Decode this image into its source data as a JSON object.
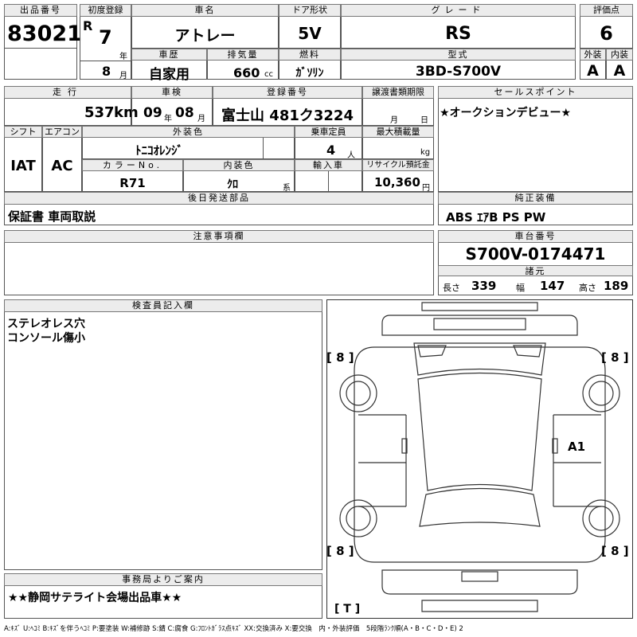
{
  "headers": {
    "lot_no": "出品番号",
    "first_reg": "初度登録",
    "car_name": "車名",
    "door": "ドア形状",
    "grade": "グレード",
    "score": "評価点",
    "history": "車歴",
    "displacement": "排気量",
    "fuel": "燃料",
    "model": "型式",
    "exterior": "外装",
    "interior": "内装",
    "mileage": "走行",
    "inspection": "車検",
    "plate": "登録番号",
    "transfer": "譲渡書類期限",
    "sales_point": "セールスポイント",
    "shift": "シフト",
    "aircon": "エアコン",
    "ext_color": "外装色",
    "capacity": "乗車定員",
    "max_load": "最大積載量",
    "color_no": "カラーNo.",
    "int_color": "内装色",
    "import": "輸入車",
    "recycle": "リサイクル預託金",
    "later_parts": "後日発送部品",
    "genuine_equip": "純正装備",
    "notes": "注意事項欄",
    "chassis_no": "車台番号",
    "dimensions": "諸元",
    "inspector": "検査員記入欄",
    "office": "事務局よりご案内"
  },
  "vehicle": {
    "lot_no": "83021",
    "era": "R",
    "year": "7",
    "year_unit": "年",
    "month": "8",
    "month_unit": "月",
    "name": "アトレー",
    "door": "5V",
    "grade": "RS",
    "score": "6",
    "history": "自家用",
    "displacement": "660",
    "displacement_unit": "cc",
    "fuel": "ｶﾞｿﾘﾝ",
    "model": "3BD-S700V",
    "ext_score": "A",
    "int_score": "A",
    "mileage": "537",
    "mileage_unit": "km",
    "inspection_year": "09",
    "inspection_year_unit": "年",
    "inspection_month": "08",
    "inspection_month_unit": "月",
    "plate": "富士山 481ク3224",
    "transfer_month_unit": "月",
    "transfer_day_unit": "日",
    "shift": "IAT",
    "aircon": "AC",
    "ext_color": "ﾄﾆｺｵﾚﾝｼﾞ",
    "capacity": "4",
    "capacity_unit": "人",
    "load_unit": "kg",
    "color_no": "R71",
    "int_color": "ｸﾛ",
    "int_color_unit": "系",
    "recycle": "10,360",
    "recycle_unit": "円",
    "later_parts": "保証書 車両取説",
    "sales_point": "★オークションデビュー★",
    "genuine_equip": "ABS ｴｱB PS PW",
    "chassis_no": "S700V-0174471",
    "length_label": "長さ",
    "length": "339",
    "width_label": "幅",
    "width": "147",
    "height_label": "高さ",
    "height": "189",
    "inspector_line1": "ステレオレス穴",
    "inspector_line2": "コンソール傷小",
    "office_note": "★★静岡サテライト会場出品車★★"
  },
  "diagram": {
    "tire_front_left": "[ 8 ]",
    "tire_front_right": "[ 8 ]",
    "tire_rear_left": "[ 8 ]",
    "tire_rear_right": "[ 8 ]",
    "mark_a1": "A1",
    "mark_t": "[ T ]"
  },
  "legend": "A:ｷｽﾞ U:ﾍｺﾐ B:ｷｽﾞを伴うﾍｺﾐ P:要塗装 W:補修跡 S:錆 C:腐食 G:ﾌﾛﾝﾄｶﾞﾗｽ点ｷｽﾞ XX:交換済み X:要交換　内・外装評価　5段階ﾗﾝｸ順(A・B・C・D・E) 2"
}
